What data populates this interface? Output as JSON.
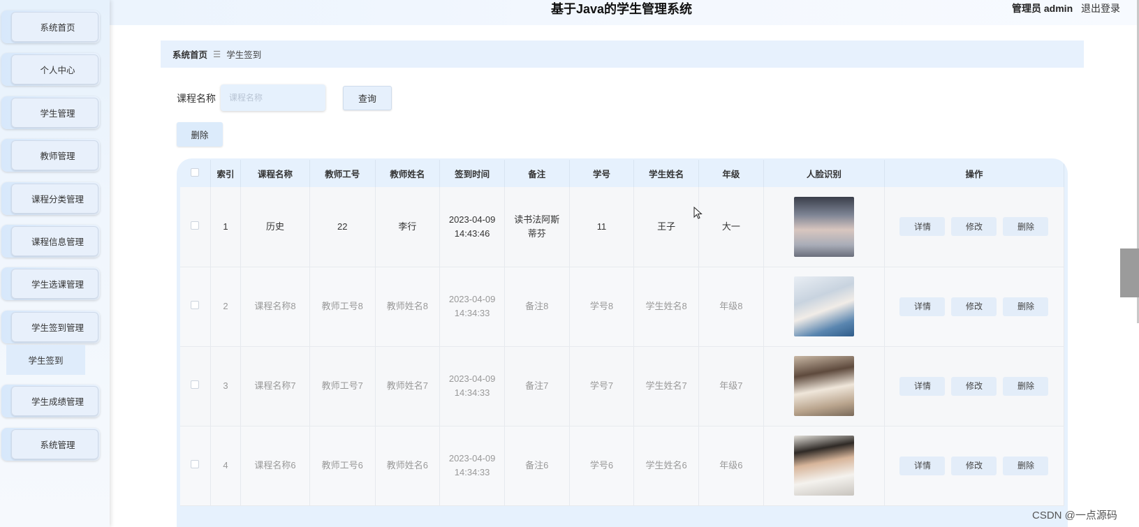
{
  "header": {
    "app_title": "基于Java的学生管理系统",
    "admin_label": "管理员 admin",
    "logout_label": "退出登录"
  },
  "sidebar": {
    "items": [
      {
        "label": "系统首页"
      },
      {
        "label": "个人中心"
      },
      {
        "label": "学生管理"
      },
      {
        "label": "教师管理"
      },
      {
        "label": "课程分类管理"
      },
      {
        "label": "课程信息管理"
      },
      {
        "label": "学生选课管理"
      },
      {
        "label": "学生签到管理"
      },
      {
        "label": "学生成绩管理"
      },
      {
        "label": "系统管理"
      }
    ],
    "submenu_label": "学生签到"
  },
  "breadcrumb": {
    "home": "系统首页",
    "separator": "☰",
    "current": "学生签到"
  },
  "search": {
    "label": "课程名称",
    "placeholder": "课程名称",
    "query_button": "查询",
    "delete_button": "删除"
  },
  "table": {
    "headers": [
      "索引",
      "课程名称",
      "教师工号",
      "教师姓名",
      "签到时间",
      "备注",
      "学号",
      "学生姓名",
      "年级",
      "人脸识别",
      "操作"
    ],
    "rows": [
      {
        "index": "1",
        "course": "历史",
        "teacher_id": "22",
        "teacher_name": "李行",
        "time_date": "2023-04-09",
        "time_clock": "14:43:46",
        "note": "读书法阿斯蒂芬",
        "student_id": "11",
        "student_name": "王子",
        "grade": "大一"
      },
      {
        "index": "2",
        "course": "课程名称8",
        "teacher_id": "教师工号8",
        "teacher_name": "教师姓名8",
        "time_date": "2023-04-09",
        "time_clock": "14:34:33",
        "note": "备注8",
        "student_id": "学号8",
        "student_name": "学生姓名8",
        "grade": "年级8"
      },
      {
        "index": "3",
        "course": "课程名称7",
        "teacher_id": "教师工号7",
        "teacher_name": "教师姓名7",
        "time_date": "2023-04-09",
        "time_clock": "14:34:33",
        "note": "备注7",
        "student_id": "学号7",
        "student_name": "学生姓名7",
        "grade": "年级7"
      },
      {
        "index": "4",
        "course": "课程名称6",
        "teacher_id": "教师工号6",
        "teacher_name": "教师姓名6",
        "time_date": "2023-04-09",
        "time_clock": "14:34:33",
        "note": "备注6",
        "student_id": "学号6",
        "student_name": "学生姓名6",
        "grade": "年级6"
      }
    ],
    "actions": {
      "detail": "详情",
      "edit": "修改",
      "delete": "删除"
    }
  },
  "watermark": "CSDN @一点源码"
}
